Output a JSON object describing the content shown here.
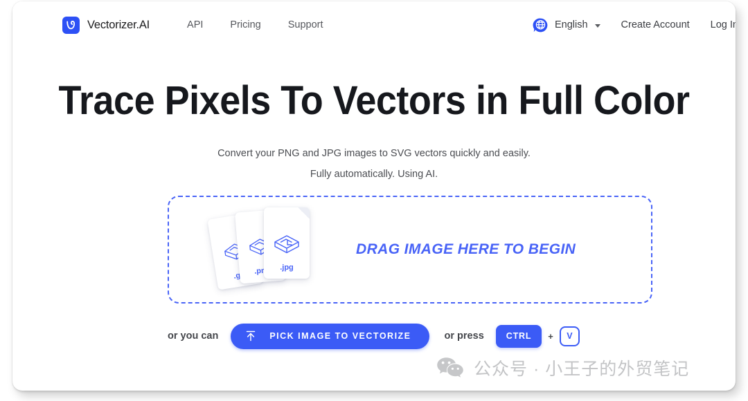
{
  "header": {
    "brand_name": "Vectorizer.AI",
    "logo_icon": "vectorizer-v-logo",
    "nav": [
      {
        "label": "API"
      },
      {
        "label": "Pricing"
      },
      {
        "label": "Support"
      }
    ],
    "language": {
      "icon": "globe-icon",
      "label": "English",
      "caret": "chevron-down-icon"
    },
    "create_account_label": "Create Account",
    "login_label": "Log In"
  },
  "hero": {
    "title": "Trace Pixels To Vectors in Full Color",
    "subtitle_line1": "Convert your PNG and JPG images to SVG vectors quickly and easily.",
    "subtitle_line2": "Fully automatically. Using AI."
  },
  "dropzone": {
    "prompt": "DRAG IMAGE HERE TO BEGIN",
    "files": [
      {
        "name": ".gif",
        "icon": "image-file-icon"
      },
      {
        "name": ".png",
        "icon": "image-file-icon"
      },
      {
        "name": ".jpg",
        "icon": "image-file-icon"
      }
    ]
  },
  "actions": {
    "or_you_can": "or you can",
    "pick_button_label": "PICK IMAGE TO VECTORIZE",
    "pick_button_icon": "upload-icon",
    "or_press": "or press",
    "key_ctrl": "CTRL",
    "key_plus": "+",
    "key_v": "V"
  },
  "watermark": {
    "icon": "wechat-icon",
    "text": "公众号 · 小王子的外贸笔记"
  },
  "colors": {
    "brand_blue": "#3b5bf6",
    "dashed_border": "#4863f7",
    "text_dark": "#16181d",
    "text_muted": "#55575c",
    "watermark_gray": "#c3c4c6"
  }
}
